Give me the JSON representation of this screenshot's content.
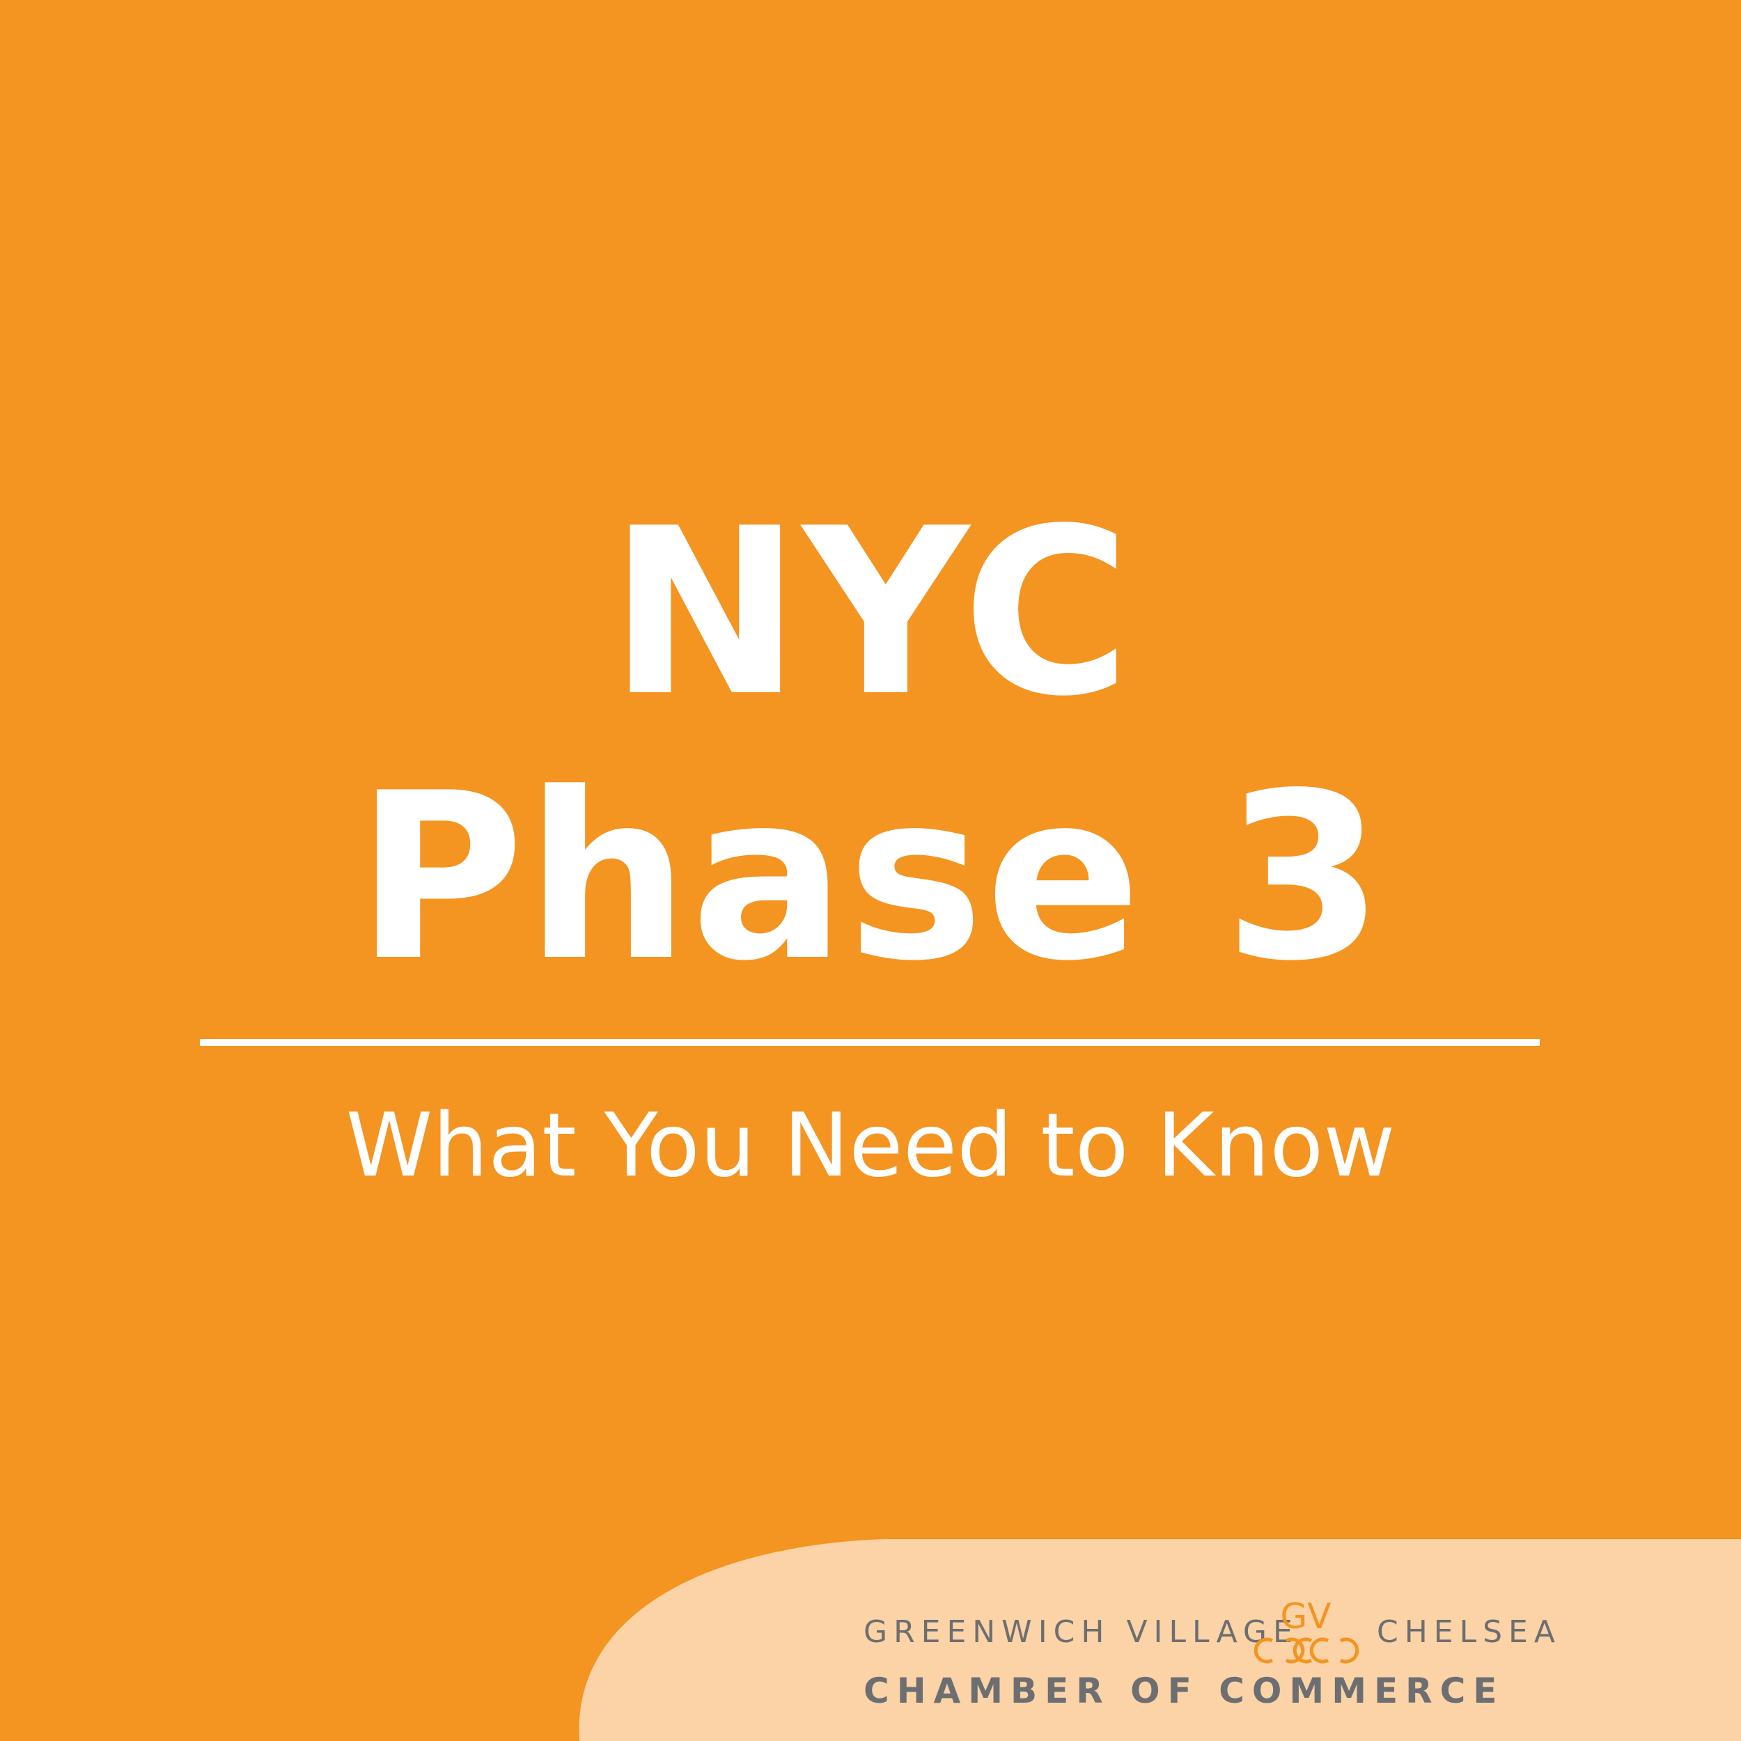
{
  "colors": {
    "background": "#F49421",
    "corner_panel": "#FBD3A6",
    "text": "#FFFFFF",
    "logo_gray": "#6D6E71",
    "logo_orange": "#F49421"
  },
  "title": {
    "line1": "NYC",
    "line2": "Phase 3"
  },
  "subtitle": "What You Need to Know",
  "logo": {
    "left_text": "GREENWICH VILLAGE",
    "right_text": "CHELSEA",
    "mark_letters": "GV",
    "bottom_text": "CHAMBER OF COMMERCE"
  }
}
